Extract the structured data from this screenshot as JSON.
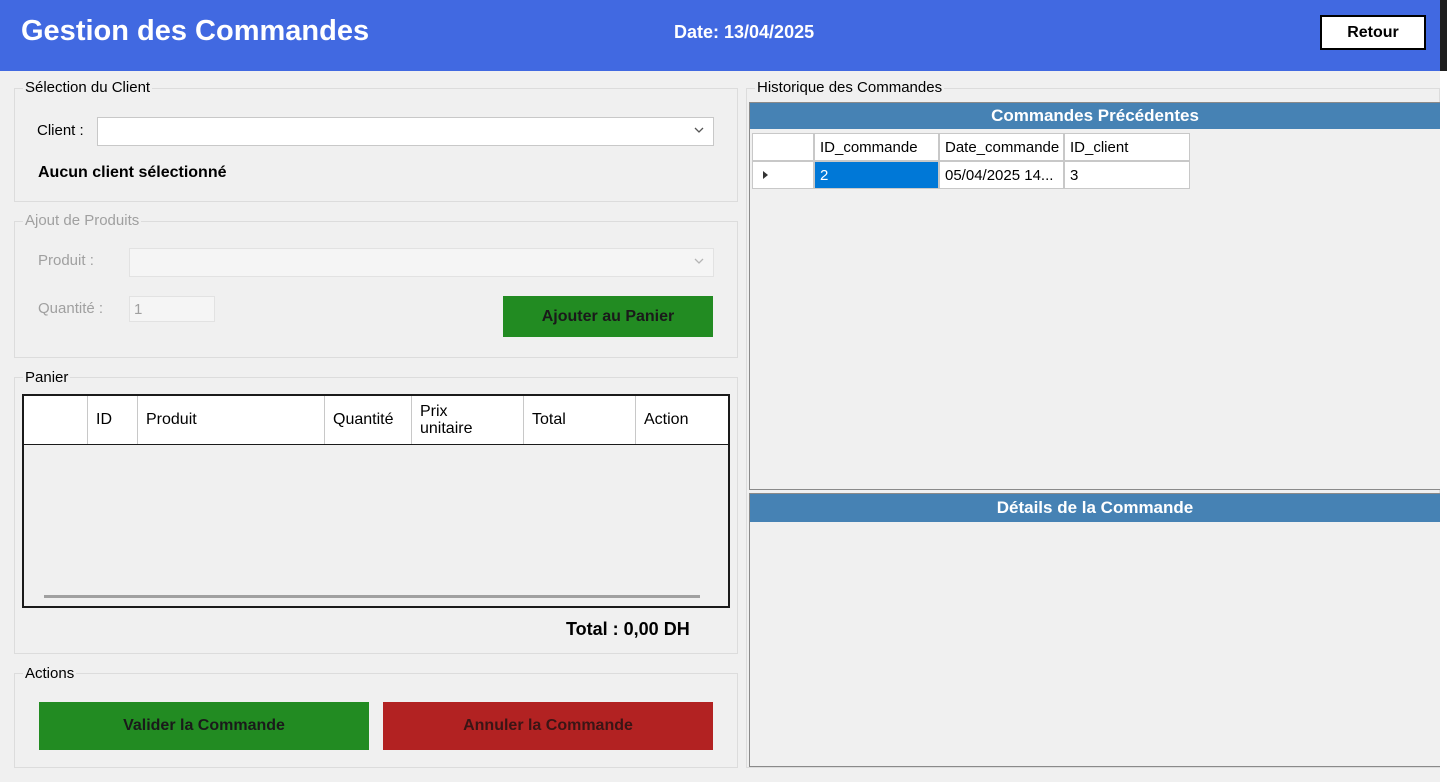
{
  "header": {
    "title": "Gestion des Commandes",
    "date": "Date: 13/04/2025",
    "back_label": "Retour",
    "color": "#4169e1"
  },
  "client_section": {
    "label": "Sélection du Client",
    "client_label": "Client :",
    "client_value": "",
    "status_text": "Aucun client sélectionné"
  },
  "product_section": {
    "label": "Ajout de Produits",
    "product_label": "Produit :",
    "product_value": "",
    "quantity_label": "Quantité :",
    "quantity_value": "1",
    "add_button": "Ajouter au Panier"
  },
  "cart": {
    "label": "Panier",
    "columns": [
      "ID",
      "Produit",
      "Quantité",
      "Prix unitaire",
      "Total",
      "Action"
    ],
    "rows": [],
    "total_text": "Total : 0,00 DH"
  },
  "actions": {
    "label": "Actions",
    "validate_button": "Valider la Commande",
    "cancel_button": "Annuler la Commande",
    "validate_color": "#228b22",
    "cancel_color": "#b22222"
  },
  "history": {
    "label": "Historique des Commandes",
    "panel_title": "Commandes Précédentes",
    "columns": [
      "ID_commande",
      "Date_commande",
      "ID_client"
    ],
    "rows": [
      {
        "id_commande": "2",
        "date_commande": "05/04/2025 14...",
        "id_client": "3"
      }
    ]
  },
  "details": {
    "panel_title": "Détails de la Commande"
  },
  "icons": {
    "dropdown": "chevron-down-icon",
    "row_indicator": "row-pointer-icon"
  }
}
